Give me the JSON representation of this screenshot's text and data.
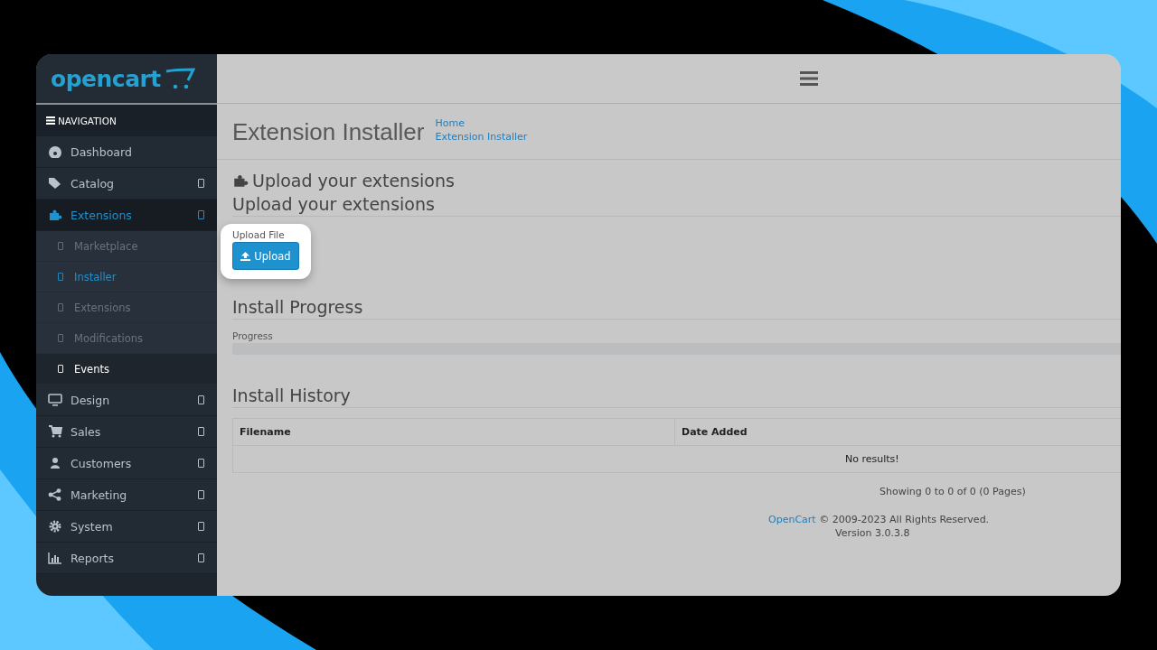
{
  "logo": {
    "text": "opencart"
  },
  "navigation": {
    "title": "NAVIGATION",
    "items": [
      {
        "label": "Dashboard",
        "selected": false,
        "expandable": false
      },
      {
        "label": "Catalog",
        "selected": false,
        "expandable": true
      },
      {
        "label": "Extensions",
        "selected": true,
        "expandable": true,
        "children": [
          {
            "label": "Marketplace",
            "selected": false,
            "hovered": false
          },
          {
            "label": "Installer",
            "selected": true,
            "hovered": false
          },
          {
            "label": "Extensions",
            "selected": false,
            "hovered": false
          },
          {
            "label": "Modifications",
            "selected": false,
            "hovered": false
          },
          {
            "label": "Events",
            "selected": false,
            "hovered": true
          }
        ]
      },
      {
        "label": "Design",
        "selected": false,
        "expandable": true
      },
      {
        "label": "Sales",
        "selected": false,
        "expandable": true
      },
      {
        "label": "Customers",
        "selected": false,
        "expandable": true
      },
      {
        "label": "Marketing",
        "selected": false,
        "expandable": true
      },
      {
        "label": "System",
        "selected": false,
        "expandable": true
      },
      {
        "label": "Reports",
        "selected": false,
        "expandable": true
      }
    ]
  },
  "page": {
    "title": "Extension Installer",
    "breadcrumbs": [
      "Home",
      "Extension Installer"
    ]
  },
  "panel": {
    "heading": "Upload your extensions",
    "legend": "Upload your extensions",
    "upload_label": "Upload File",
    "upload_button": "Upload"
  },
  "progress": {
    "legend": "Install Progress",
    "label": "Progress",
    "level": 0
  },
  "history": {
    "legend": "Install History",
    "columns": [
      "Filename",
      "Date Added"
    ],
    "empty": "No results!",
    "pagination": "Showing 0 to 0 of 0 (0 Pages)"
  },
  "footer": {
    "link": "OpenCart",
    "text": "© 2009-2023 All Rights Reserved.",
    "version": "Version 3.0.3.8"
  }
}
